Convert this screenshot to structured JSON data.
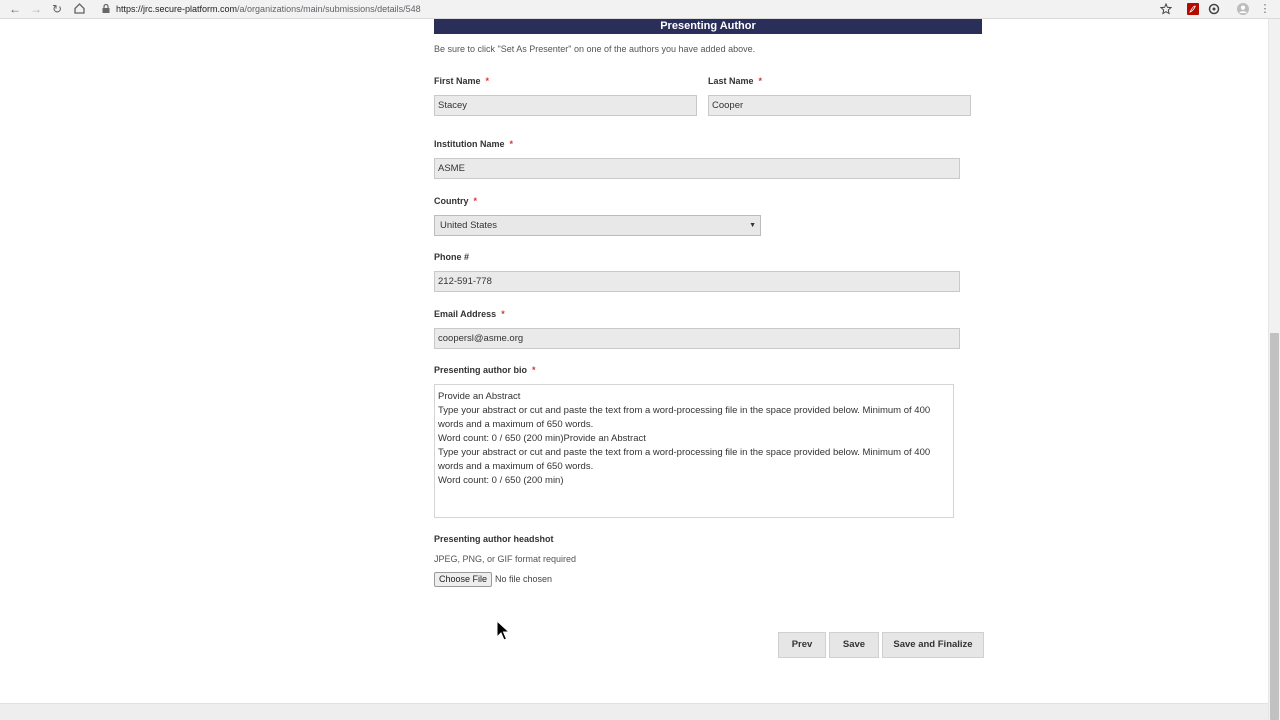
{
  "browser": {
    "url_prefix": "https://jrc.secure-platform.com",
    "url_path": "/a/organizations/main/submissions/details/548"
  },
  "section": {
    "title": "Presenting Author",
    "note": "Be sure to click \"Set As Presenter\" on one of the authors you have added above."
  },
  "form": {
    "required_mark": "*",
    "first_name": {
      "label": "First Name",
      "value": "Stacey"
    },
    "last_name": {
      "label": "Last Name",
      "value": "Cooper"
    },
    "institution": {
      "label": "Institution Name",
      "value": "ASME"
    },
    "country": {
      "label": "Country",
      "value": "United States"
    },
    "phone": {
      "label": "Phone #",
      "value": "212-591-778"
    },
    "email": {
      "label": "Email Address",
      "value": "coopersl@asme.org"
    },
    "bio": {
      "label": "Presenting author bio",
      "value": "Provide an Abstract\nType your abstract or cut and paste the text from a word-processing file in the space provided below. Minimum of 400 words and a maximum of 650 words.\nWord count: 0 / 650 (200 min)Provide an Abstract\nType your abstract or cut and paste the text from a word-processing file in the space provided below. Minimum of 400 words and a maximum of 650 words.\nWord count: 0 / 650 (200 min)"
    },
    "headshot": {
      "label": "Presenting author headshot",
      "help": "JPEG, PNG, or GIF format required",
      "button": "Choose File",
      "status": "No file chosen"
    }
  },
  "actions": {
    "prev": "Prev",
    "save": "Save",
    "finalize": "Save and Finalize"
  },
  "colors": {
    "header_bg": "#2a2f5a",
    "required": "#d33333",
    "field_bg": "#eaeaea"
  }
}
